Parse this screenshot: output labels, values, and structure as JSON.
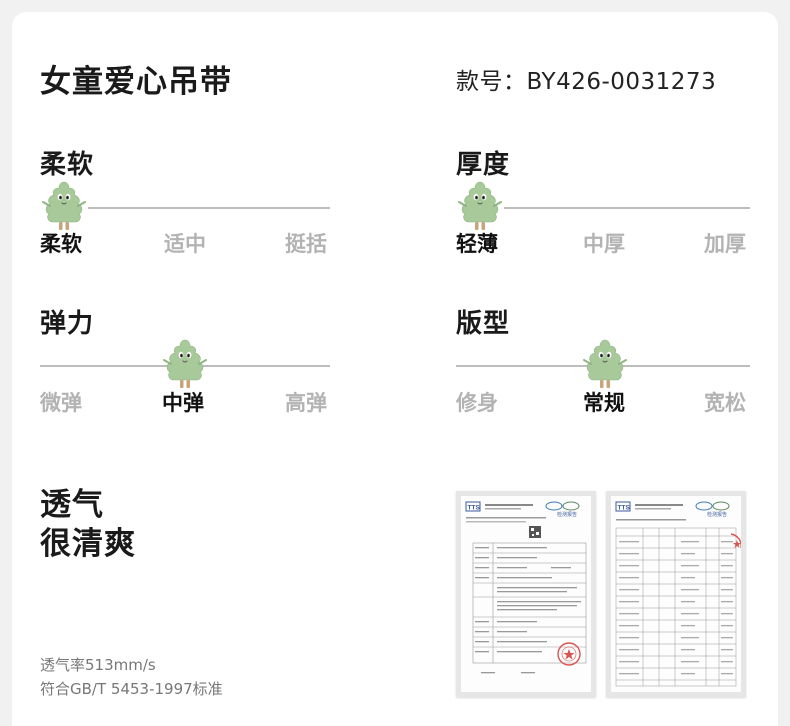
{
  "product": {
    "title": "女童爱心吊带",
    "code": "款号：BY426-0031273"
  },
  "attributes": [
    {
      "name": "柔软",
      "options": [
        "柔软",
        "适中",
        "挺括"
      ],
      "selected": 0
    },
    {
      "name": "厚度",
      "options": [
        "轻薄",
        "中厚",
        "加厚"
      ],
      "selected": 0
    },
    {
      "name": "弹力",
      "options": [
        "微弹",
        "中弹",
        "高弹"
      ],
      "selected": 1
    },
    {
      "name": "版型",
      "options": [
        "修身",
        "常规",
        "宽松"
      ],
      "selected": 1
    }
  ],
  "breathable": {
    "line1": "透气",
    "line2": "很清爽",
    "rate": "透气率513mm/s",
    "standard": "符合GB/T 5453-1997标准"
  },
  "reports": {
    "logo": "TTS",
    "heading": "检测报告"
  },
  "colors": {
    "mascot": "#a8c99a",
    "scale_line": "#bdbdbd",
    "inactive_option": "#b3b3b3",
    "stamp": "#d9534f"
  },
  "icons": {
    "mascot": "tree-mascot-icon",
    "stamp": "stamp-icon"
  }
}
